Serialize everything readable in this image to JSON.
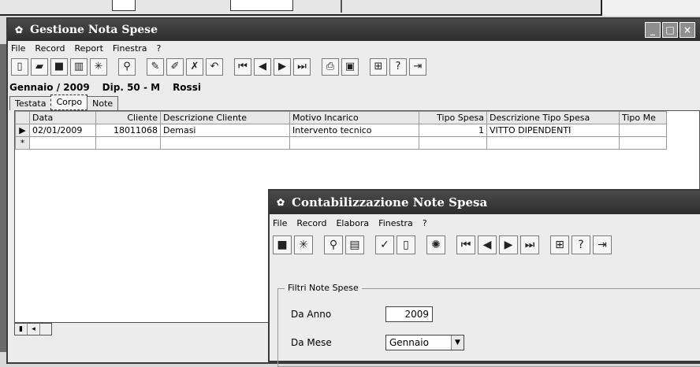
{
  "main": {
    "title": "Gestione Nota Spese",
    "menu": [
      "File",
      "Record",
      "Report",
      "Finestra",
      "?"
    ],
    "context": {
      "period": "Gennaio / 2009",
      "dept": "Dip. 50 - M",
      "name": "Rossi"
    },
    "tabs": [
      "Testata",
      "Corpo",
      "Note"
    ],
    "grid": {
      "columns": [
        "Data",
        "Cliente",
        "Descrizione Cliente",
        "Motivo Incarico",
        "Tipo Spesa",
        "Descrizione Tipo Spesa",
        "Tipo Me"
      ],
      "rows": [
        [
          "02/01/2009",
          "18011068",
          "Demasi",
          "Intervento tecnico",
          "1",
          "VITTO DIPENDENTI",
          ""
        ]
      ],
      "new_row_marker": "*",
      "current_row_marker": "▶"
    }
  },
  "second": {
    "title": "Contabilizzazione Note Spesa",
    "menu": [
      "File",
      "Record",
      "Elabora",
      "Finestra",
      "?"
    ],
    "filters_title": "Filtri Note Spese",
    "anno_label": "Da Anno",
    "anno_value": "2009",
    "mese_label": "Da Mese",
    "mese_value": "Gennaio"
  },
  "colors": {
    "titlebar": "#2e2e2e",
    "window": "#ececec"
  }
}
